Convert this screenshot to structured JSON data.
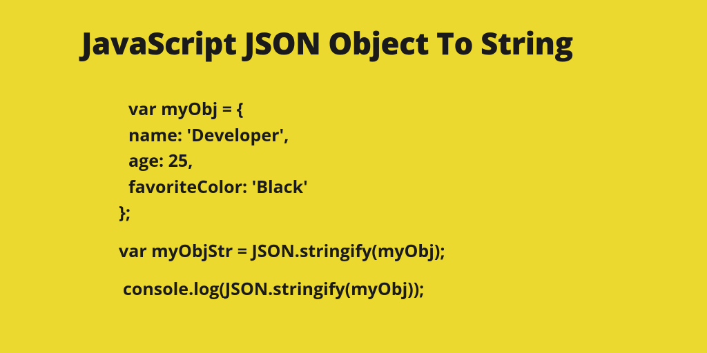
{
  "title": "JavaScript JSON Object To String",
  "code": {
    "line1": "var myObj = {",
    "line2": "name: 'Developer',",
    "line3": "age: 25,",
    "line4": "favoriteColor: 'Black'",
    "line5": "};",
    "line6": "var myObjStr = JSON.stringify(myObj);",
    "line7": "console.log(JSON.stringify(myObj));"
  }
}
